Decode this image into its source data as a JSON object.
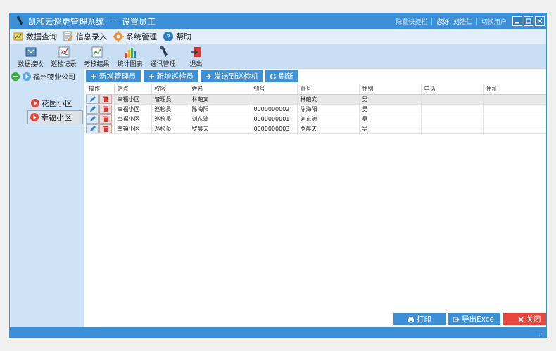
{
  "window": {
    "title": "凯和云巡更管理系统 ---- 设置员工",
    "hide_shortcut": "隐藏快捷栏",
    "greeting": "您好, 刘浩仁",
    "switch_user": "切换用户"
  },
  "menu": {
    "items": [
      {
        "label": "数据查询",
        "icon": "data-query-icon"
      },
      {
        "label": "信息录入",
        "icon": "info-entry-icon"
      },
      {
        "label": "系统管理",
        "icon": "gear-icon"
      },
      {
        "label": "帮助",
        "icon": "help-icon"
      }
    ]
  },
  "toolbar": {
    "items": [
      {
        "label": "数据接收",
        "icon": "data-receive-icon"
      },
      {
        "label": "巡检记录",
        "icon": "patrol-record-icon"
      },
      {
        "label": "考核结果",
        "icon": "assessment-result-icon"
      },
      {
        "label": "统计图表",
        "icon": "bar-chart-icon"
      },
      {
        "label": "通讯管理",
        "icon": "communication-icon"
      },
      {
        "label": "退出",
        "icon": "exit-icon"
      }
    ]
  },
  "tree": {
    "root": "福州物业公司",
    "children": [
      "花园小区",
      "幸福小区"
    ],
    "selected": "幸福小区"
  },
  "actions": {
    "add_admin": "新增管理员",
    "add_inspector": "新增巡检员",
    "send_to_device": "发送到巡检机",
    "refresh": "刷新"
  },
  "table": {
    "columns": [
      "操作",
      "站点",
      "权限",
      "姓名",
      "钮号",
      "账号",
      "性别",
      "电话",
      "住址"
    ],
    "rows": [
      {
        "site": "幸福小区",
        "role": "管理员",
        "name": "林葩文",
        "button_no": "",
        "account": "林葩文",
        "gender": "男",
        "phone": "",
        "address": ""
      },
      {
        "site": "幸福小区",
        "role": "巡检员",
        "name": "陈海阳",
        "button_no": "0000000002",
        "account": "陈海阳",
        "gender": "男",
        "phone": "",
        "address": ""
      },
      {
        "site": "幸福小区",
        "role": "巡检员",
        "name": "刘东涛",
        "button_no": "0000000001",
        "account": "刘东涛",
        "gender": "男",
        "phone": "",
        "address": ""
      },
      {
        "site": "幸福小区",
        "role": "巡检员",
        "name": "罗晨天",
        "button_no": "0000000003",
        "account": "罗晨天",
        "gender": "男",
        "phone": "",
        "address": ""
      }
    ]
  },
  "footer": {
    "print": "打印",
    "export_excel": "导出Excel",
    "close": "关闭"
  },
  "colors": {
    "accent": "#3d8fd6",
    "close_button": "#e8453c",
    "delete_icon": "#d93a32",
    "tree_arrow": "#e5463a",
    "tree_root_toggle": "#3fae49"
  }
}
